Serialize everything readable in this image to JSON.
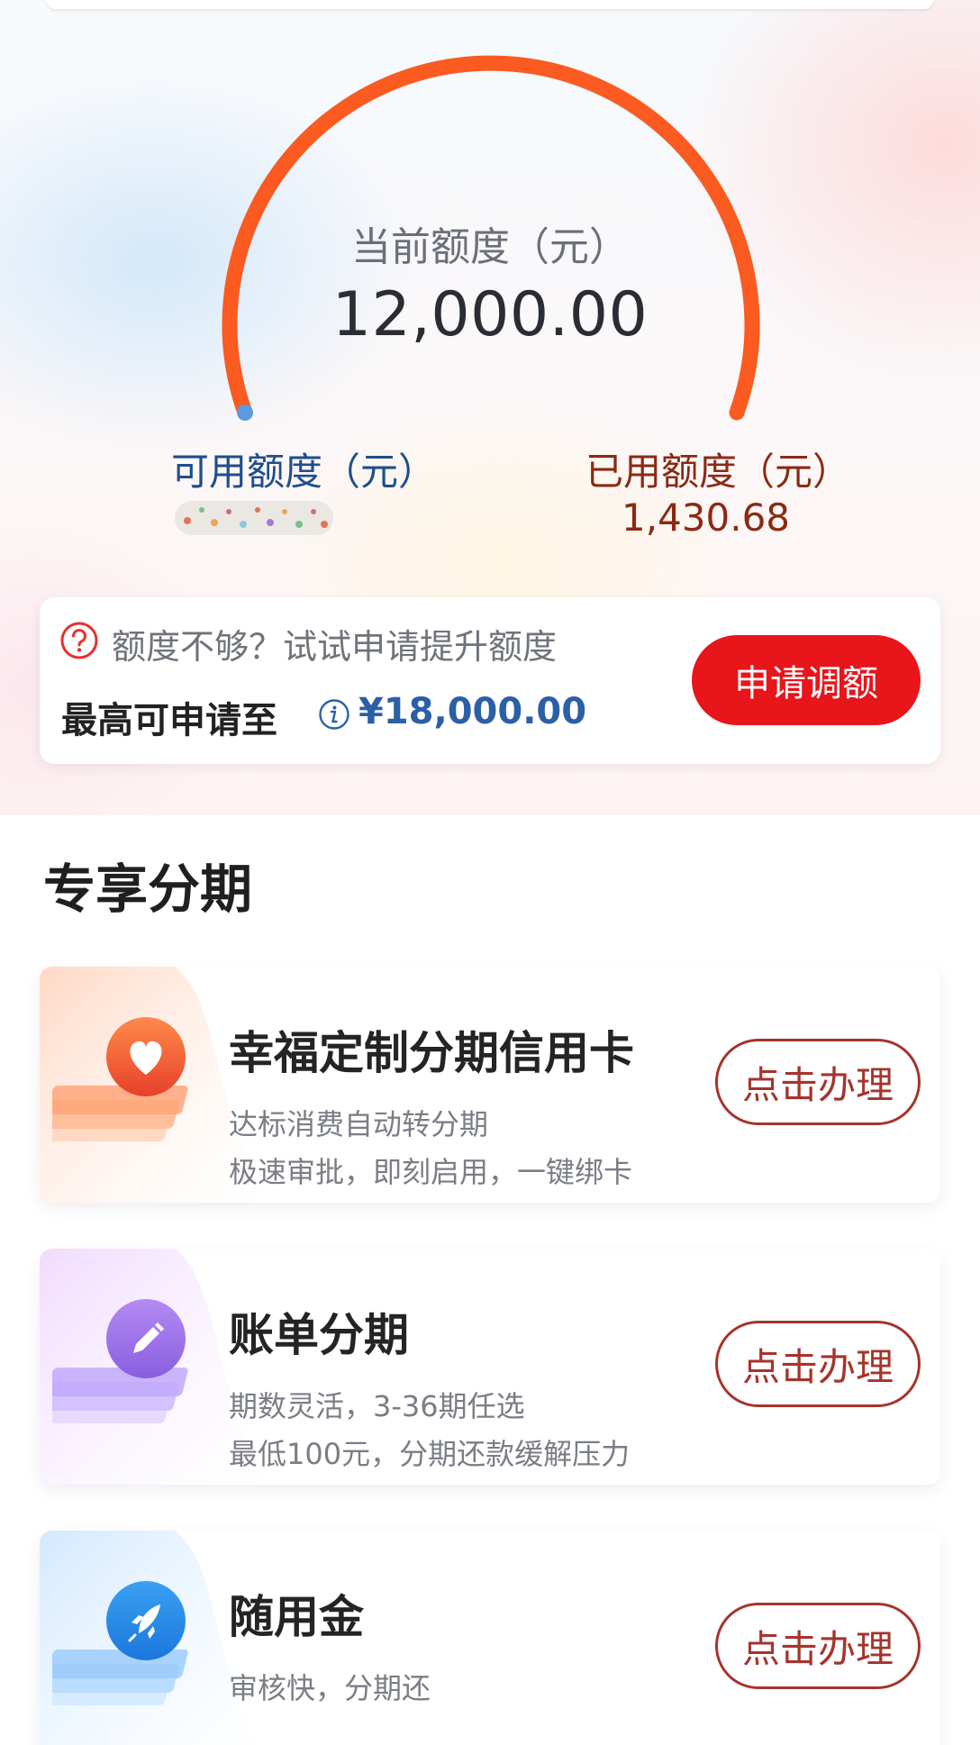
{
  "gauge": {
    "current_label": "当前额度（元）",
    "current_value": "12,000.00",
    "available_label": "可用额度（元）",
    "used_label": "已用额度（元）",
    "used_value": "1,430.68",
    "arc_color": "#fb5a20",
    "start_dot_color": "#5b9be0"
  },
  "upgrade": {
    "hint": "额度不够？试试申请提升额度",
    "max_label": "最高可申请至",
    "max_value": "¥18,000.00",
    "apply_button": "申请调额",
    "apply_button_color": "#e8151b"
  },
  "installments": {
    "title": "专享分期",
    "products": [
      {
        "title": "幸福定制分期信用卡",
        "line1": "达标消费自动转分期",
        "line2": "极速审批，即刻启用，一键绑卡",
        "button": "点击办理",
        "icon": "heart-icon",
        "accent": "#f06a3a"
      },
      {
        "title": "账单分期",
        "line1": "期数灵活，3-36期任选",
        "line2": "最低100元，分期还款缓解压力",
        "button": "点击办理",
        "icon": "pencil-icon",
        "accent": "#9b6ce6"
      },
      {
        "title": "随用金",
        "line1": "审核快，分期还",
        "line2": "",
        "button": "点击办理",
        "icon": "rocket-icon",
        "accent": "#2f8ee8"
      }
    ]
  }
}
